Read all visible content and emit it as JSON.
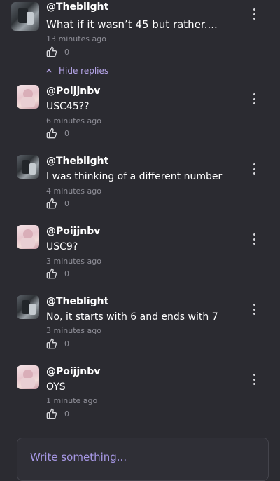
{
  "comments": [
    {
      "username": "@Theblight",
      "text": "What if it wasn’t 45 but rather....",
      "time": "13 minutes ago",
      "likes": "0",
      "avatar": "dark-avatar"
    },
    {
      "username": "@Poijjnbv",
      "text": "USC45??",
      "time": "6 minutes ago",
      "likes": "0",
      "avatar": "pink-avatar"
    },
    {
      "username": "@Theblight",
      "text": "I was thinking of a different number",
      "time": "4 minutes ago",
      "likes": "0",
      "avatar": "dark-avatar"
    },
    {
      "username": "@Poijjnbv",
      "text": "USC9?",
      "time": "3 minutes ago",
      "likes": "0",
      "avatar": "pink-avatar"
    },
    {
      "username": "@Theblight",
      "text": "No, it starts with 6 and ends with 7",
      "time": "3 minutes ago",
      "likes": "0",
      "avatar": "dark-avatar"
    },
    {
      "username": "@Poijjnbv",
      "text": "OYS",
      "time": "1 minute ago",
      "likes": "0",
      "avatar": "pink-avatar"
    }
  ],
  "replies_toggle": {
    "label": "Hide replies"
  },
  "composer": {
    "placeholder": "Write something..."
  },
  "colors": {
    "background": "#2b2b31",
    "accent": "#b7a6ea",
    "muted": "#8e8e97"
  },
  "icons": {
    "like": "thumbs-up-icon",
    "menu": "more-vertical-icon",
    "toggle": "chevron-up-icon"
  }
}
